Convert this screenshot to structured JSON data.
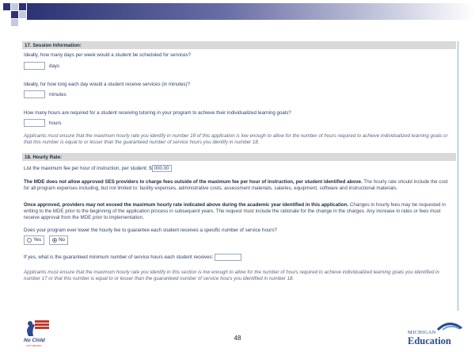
{
  "form": {
    "section17": {
      "heading": "17. Session Information:",
      "q1": "Ideally, how many days per week would a student be scheduled for services?",
      "q1_unit": "days",
      "q2": "Ideally, for how long each day would a student receive services (in minutes)?",
      "q2_unit": "minutes",
      "q3": "How many hours are required for a student receiving tutoring in your program to achieve their individualized learning goals?",
      "q3_unit": "hours",
      "note": "Applicants must ensure that the maximum hourly rate you identify in number 18 of this application is low enough to allow for the number of hours required to achieve individualized learning goals or that this number is equal to or lesser than the guaranteed number of service hours you identify in number 18."
    },
    "section18": {
      "heading": "18. Hourly Rate:",
      "fee_label": "List the maximum fee per hour of instruction, per student: $",
      "fee_value": "000.00",
      "para1_bold": "The MDE does not allow approved SES providers to charge fees outside of the maximum fee per hour of instruction, per student identified above.",
      "para1_rest": " The hourly rate should include the cost for all program expenses including, but not limited to: facility expenses, administrative costs, assessment materials, salaries, equipment, software and instructional materials.",
      "para2_bold": "Once approved, providers may not exceed the maximum hourly rate indicated above during the academic year identified in this application.",
      "para2_rest": " Changes in hourly fees may be requested in writing to the MDE prior to the beginning of the application process in subsequent years. The request must include the rationale for the change in the charges. Any increase in rates or fees must receive approval from the MDE prior to implementation.",
      "q_lower": "Does your program ever lower the hourly fee to guarantee each student receives a specific number of service hours?",
      "radio_yes": "Yes",
      "radio_no": "No",
      "q_min": "If yes, what is the guaranteed minimum number of service hours each student receives:",
      "note": "Applicants must ensure that the maximum hourly rate you identify in this section is low enough to allow for the number of hours required to achieve individualized learning goals you identified in number 17 or that this number is equal to or lesser than the guaranteed number of service hours you identified in number 18."
    }
  },
  "footer": {
    "left_logo_text": "No Child",
    "left_logo_sub": "LEFT BEHIND",
    "page_number": "48",
    "right_logo_top": "MICHIGAN",
    "right_logo_bottom": "Education"
  },
  "colors": {
    "banner_dark": "#2c3273",
    "section_bg": "#d9d9d9",
    "text": "#2e3f6e"
  }
}
